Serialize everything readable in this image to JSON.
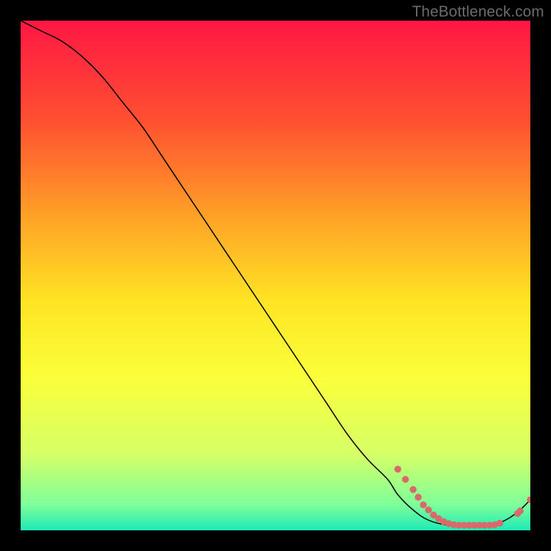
{
  "watermark": "TheBottleneck.com",
  "chart_data": {
    "type": "line",
    "title": "",
    "xlabel": "",
    "ylabel": "",
    "xlim": [
      0,
      100
    ],
    "ylim": [
      0,
      100
    ],
    "background_gradient": {
      "stops": [
        {
          "offset": 0.0,
          "color": "#ff1744"
        },
        {
          "offset": 0.2,
          "color": "#ff5131"
        },
        {
          "offset": 0.4,
          "color": "#ffa826"
        },
        {
          "offset": 0.55,
          "color": "#ffe423"
        },
        {
          "offset": 0.7,
          "color": "#faff3a"
        },
        {
          "offset": 0.85,
          "color": "#d6ff66"
        },
        {
          "offset": 0.95,
          "color": "#7dff9a"
        },
        {
          "offset": 1.0,
          "color": "#1de9b6"
        }
      ]
    },
    "series": [
      {
        "name": "bottleneck-curve",
        "color": "#000000",
        "stroke_width": 1.6,
        "x": [
          0,
          4,
          8,
          12,
          16,
          20,
          24,
          28,
          32,
          36,
          40,
          44,
          48,
          52,
          56,
          60,
          64,
          68,
          72,
          74,
          77,
          80,
          84,
          88,
          92,
          94,
          96,
          98,
          100
        ],
        "y": [
          100,
          98,
          96,
          93,
          89,
          84,
          79,
          73,
          67,
          61,
          55,
          49,
          43,
          37,
          31,
          25,
          19,
          14,
          10,
          7,
          4,
          2,
          1,
          1,
          1,
          1.5,
          2.5,
          4,
          6
        ]
      }
    ],
    "points": [
      {
        "x": 74.0,
        "y": 12.0
      },
      {
        "x": 75.5,
        "y": 10.0
      },
      {
        "x": 77.0,
        "y": 8.0
      },
      {
        "x": 78.0,
        "y": 6.5
      },
      {
        "x": 79.0,
        "y": 5.0
      },
      {
        "x": 80.0,
        "y": 4.0
      },
      {
        "x": 81.0,
        "y": 3.0
      },
      {
        "x": 82.0,
        "y": 2.3
      },
      {
        "x": 83.0,
        "y": 1.7
      },
      {
        "x": 84.0,
        "y": 1.3
      },
      {
        "x": 85.0,
        "y": 1.1
      },
      {
        "x": 86.0,
        "y": 1.0
      },
      {
        "x": 87.0,
        "y": 1.0
      },
      {
        "x": 88.0,
        "y": 1.0
      },
      {
        "x": 89.0,
        "y": 1.0
      },
      {
        "x": 90.0,
        "y": 1.0
      },
      {
        "x": 91.0,
        "y": 1.0
      },
      {
        "x": 92.0,
        "y": 1.0
      },
      {
        "x": 93.0,
        "y": 1.1
      },
      {
        "x": 94.0,
        "y": 1.4
      },
      {
        "x": 97.5,
        "y": 3.3
      },
      {
        "x": 98.0,
        "y": 3.8
      },
      {
        "x": 100.0,
        "y": 6.0
      }
    ],
    "point_style": {
      "color": "#d9696b",
      "radius": 5
    }
  }
}
